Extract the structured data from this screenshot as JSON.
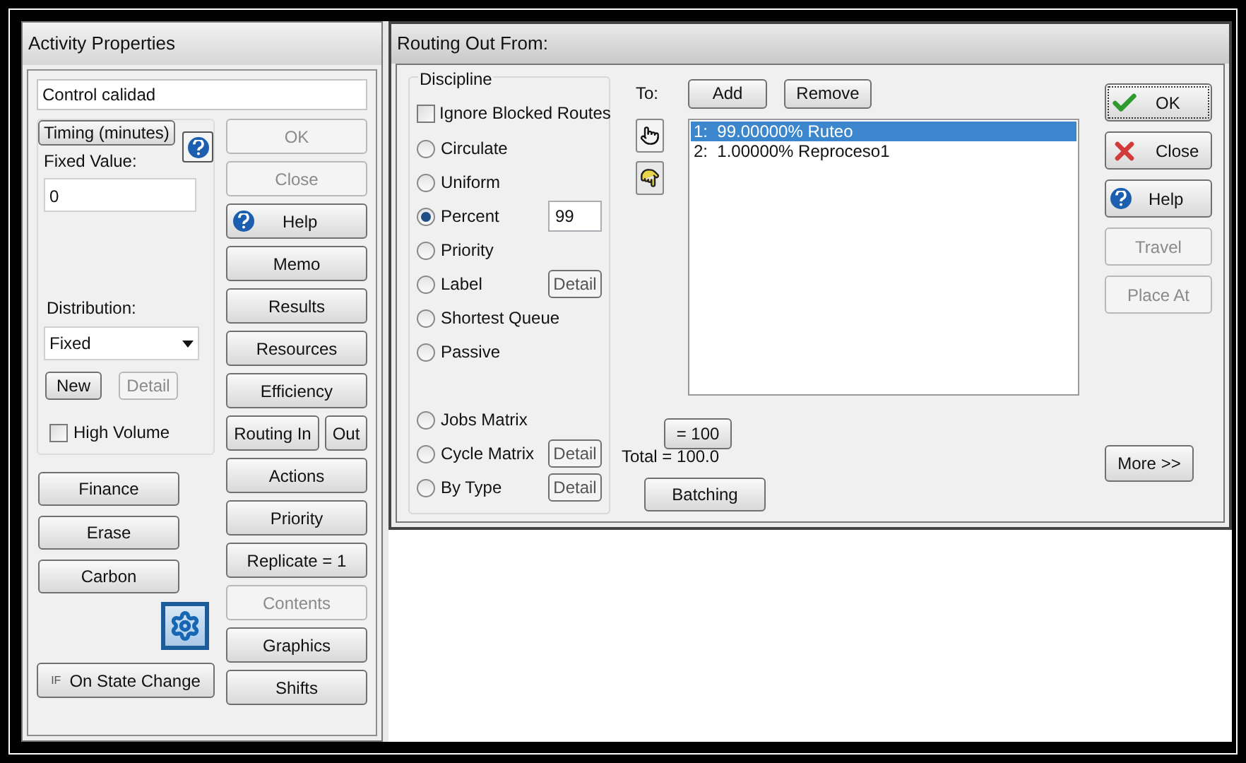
{
  "activity": {
    "title": "Activity Properties",
    "name": "Control calidad",
    "timing": {
      "button": "Timing (minutes)",
      "fixed_label": "Fixed Value:",
      "fixed_value": "0",
      "distribution_label": "Distribution:",
      "distribution": "Fixed",
      "new_button": {
        "label": "New",
        "disabled": false
      },
      "detail_button": {
        "label": "Detail",
        "disabled": true
      },
      "high_volume": {
        "label": "High Volume",
        "checked": false
      }
    },
    "left_buttons": [
      "Finance",
      "Erase",
      "Carbon"
    ],
    "state_button": {
      "prefix": "IF",
      "label": "On State Change"
    },
    "side_buttons": [
      {
        "kind": "plain",
        "label": "OK",
        "disabled": true
      },
      {
        "kind": "plain",
        "label": "Close",
        "disabled": true
      },
      {
        "kind": "help",
        "label": "Help",
        "disabled": false
      },
      {
        "kind": "plain",
        "label": "Memo",
        "disabled": false
      },
      {
        "kind": "plain",
        "label": "Results",
        "disabled": false
      },
      {
        "kind": "plain",
        "label": "Resources",
        "disabled": false
      },
      {
        "kind": "plain",
        "label": "Efficiency",
        "disabled": false
      },
      {
        "kind": "split",
        "label": "Routing In",
        "second": "Out",
        "disabled": false
      },
      {
        "kind": "plain",
        "label": "Actions",
        "disabled": false
      },
      {
        "kind": "plain",
        "label": "Priority",
        "disabled": false
      },
      {
        "kind": "plain",
        "label": "Replicate = 1",
        "disabled": false
      },
      {
        "kind": "plain",
        "label": "Contents",
        "disabled": true
      },
      {
        "kind": "plain",
        "label": "Graphics",
        "disabled": false
      },
      {
        "kind": "plain",
        "label": "Shifts",
        "disabled": false
      }
    ]
  },
  "routing": {
    "title": "Routing Out From:",
    "discipline": {
      "title": "Discipline",
      "ignore_blocked": {
        "label": "Ignore Blocked Routes",
        "checked": false
      },
      "options": [
        {
          "label": "Circulate",
          "selected": false
        },
        {
          "label": "Uniform",
          "selected": false
        },
        {
          "label": "Percent",
          "selected": true,
          "value": "99"
        },
        {
          "label": "Priority",
          "selected": false
        },
        {
          "label": "Label",
          "selected": false,
          "detail": "Detail"
        },
        {
          "label": "Shortest Queue",
          "selected": false
        },
        {
          "label": "Passive",
          "selected": false
        }
      ],
      "matrix_options": [
        {
          "label": "Jobs Matrix",
          "selected": false
        },
        {
          "label": "Cycle Matrix",
          "selected": false,
          "detail": "Detail"
        },
        {
          "label": "By Type",
          "selected": false,
          "detail": "Detail"
        }
      ]
    },
    "to_label": "To:",
    "add": "Add",
    "remove": "Remove",
    "destinations": [
      {
        "text": "1:  99.00000% Ruteo",
        "selected": true
      },
      {
        "text": "2:  1.00000% Reproceso1",
        "selected": false
      }
    ],
    "equals_button": "= 100",
    "total": "Total = 100.0",
    "batching": "Batching",
    "actions": [
      {
        "kind": "ok",
        "label": "OK",
        "disabled": false,
        "focused": true
      },
      {
        "kind": "close",
        "label": "Close",
        "disabled": false,
        "focused": false
      },
      {
        "kind": "help",
        "label": "Help",
        "disabled": false,
        "focused": false
      },
      {
        "kind": "plain",
        "label": "Travel",
        "disabled": true,
        "focused": false
      },
      {
        "kind": "plain",
        "label": "Place At",
        "disabled": true,
        "focused": false
      }
    ],
    "more": "More >>"
  }
}
